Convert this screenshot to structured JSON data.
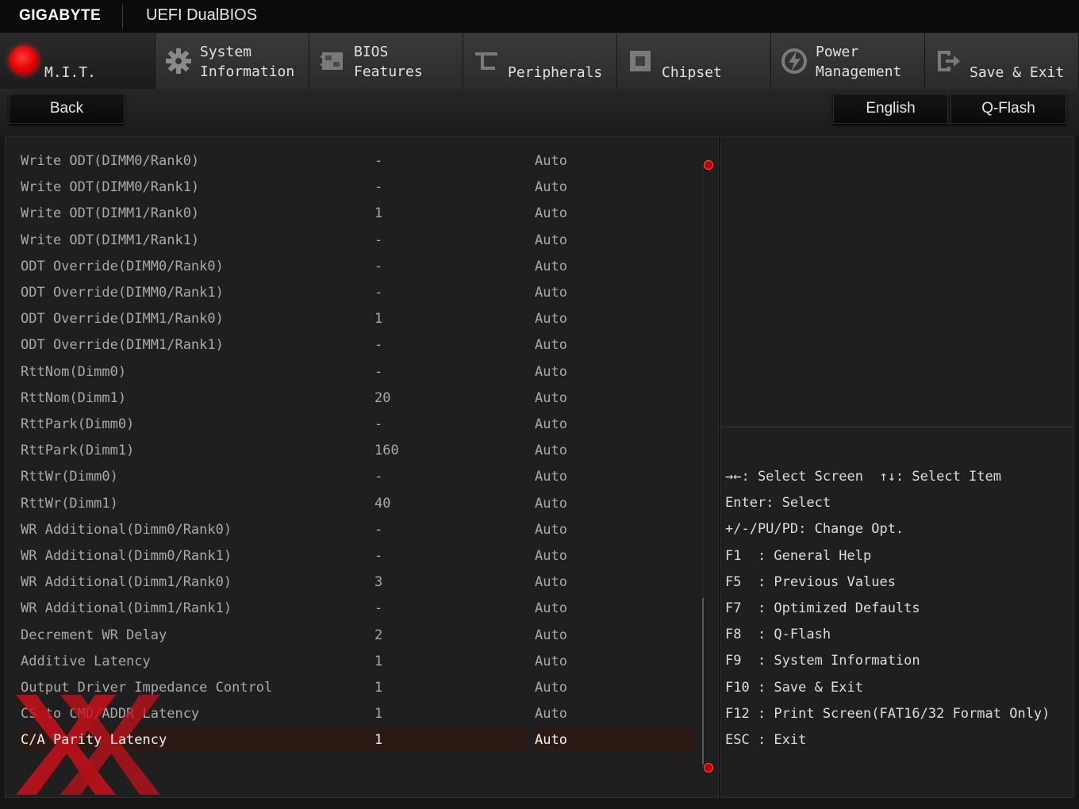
{
  "header": {
    "brand": "GIGABYTE",
    "product": "UEFI DualBIOS"
  },
  "tabs": [
    {
      "label": "M.I.T.",
      "icon": "mit-red-dot-icon",
      "active": true
    },
    {
      "label": "System\nInformation",
      "icon": "gear-icon"
    },
    {
      "label": "BIOS\nFeatures",
      "icon": "bios-chip-icon"
    },
    {
      "label": "Peripherals",
      "icon": "peripherals-icon"
    },
    {
      "label": "Chipset",
      "icon": "chipset-icon"
    },
    {
      "label": "Power\nManagement",
      "icon": "power-icon"
    },
    {
      "label": "Save & Exit",
      "icon": "exit-icon"
    }
  ],
  "toolbar": {
    "back_label": "Back",
    "language_label": "English",
    "qflash_label": "Q-Flash"
  },
  "settings": [
    {
      "name": "Write ODT(DIMM0/Rank0)",
      "current": "-",
      "value": "Auto"
    },
    {
      "name": "Write ODT(DIMM0/Rank1)",
      "current": "-",
      "value": "Auto"
    },
    {
      "name": "Write ODT(DIMM1/Rank0)",
      "current": "1",
      "value": "Auto"
    },
    {
      "name": "Write ODT(DIMM1/Rank1)",
      "current": "-",
      "value": "Auto"
    },
    {
      "name": "ODT Override(DIMM0/Rank0)",
      "current": "-",
      "value": "Auto"
    },
    {
      "name": "ODT Override(DIMM0/Rank1)",
      "current": "-",
      "value": "Auto"
    },
    {
      "name": "ODT Override(DIMM1/Rank0)",
      "current": "1",
      "value": "Auto"
    },
    {
      "name": "ODT Override(DIMM1/Rank1)",
      "current": "-",
      "value": "Auto"
    },
    {
      "name": "RttNom(Dimm0)",
      "current": "-",
      "value": "Auto"
    },
    {
      "name": "RttNom(Dimm1)",
      "current": "20",
      "value": "Auto"
    },
    {
      "name": "RttPark(Dimm0)",
      "current": "-",
      "value": "Auto"
    },
    {
      "name": "RttPark(Dimm1)",
      "current": "160",
      "value": "Auto"
    },
    {
      "name": "RttWr(Dimm0)",
      "current": "-",
      "value": "Auto"
    },
    {
      "name": "RttWr(Dimm1)",
      "current": "40",
      "value": "Auto"
    },
    {
      "name": "WR Additional(Dimm0/Rank0)",
      "current": "-",
      "value": "Auto"
    },
    {
      "name": "WR Additional(Dimm0/Rank1)",
      "current": "-",
      "value": "Auto"
    },
    {
      "name": "WR Additional(Dimm1/Rank0)",
      "current": "3",
      "value": "Auto"
    },
    {
      "name": "WR Additional(Dimm1/Rank1)",
      "current": "-",
      "value": "Auto"
    },
    {
      "name": "Decrement WR Delay",
      "current": "2",
      "value": "Auto"
    },
    {
      "name": "Additive Latency",
      "current": "1",
      "value": "Auto"
    },
    {
      "name": "Output Driver Impedance Control",
      "current": "1",
      "value": "Auto"
    },
    {
      "name": "CS to CMD/ADDR Latency",
      "current": "1",
      "value": "Auto"
    },
    {
      "name": "C/A Parity Latency",
      "current": "1",
      "value": "Auto",
      "selected": true
    }
  ],
  "help": [
    "→←: Select Screen  ↑↓: Select Item",
    "Enter: Select",
    "+/-/PU/PD: Change Opt.",
    "F1  : General Help",
    "F5  : Previous Values",
    "F7  : Optimized Defaults",
    "F8  : Q-Flash",
    "F9  : System Information",
    "F10 : Save & Exit",
    "F12 : Print Screen(FAT16/32 Format Only)",
    "ESC : Exit"
  ],
  "colors": {
    "accent": "#e00000",
    "selected_row": "#2b1a14",
    "watermark": "#c8101a"
  }
}
